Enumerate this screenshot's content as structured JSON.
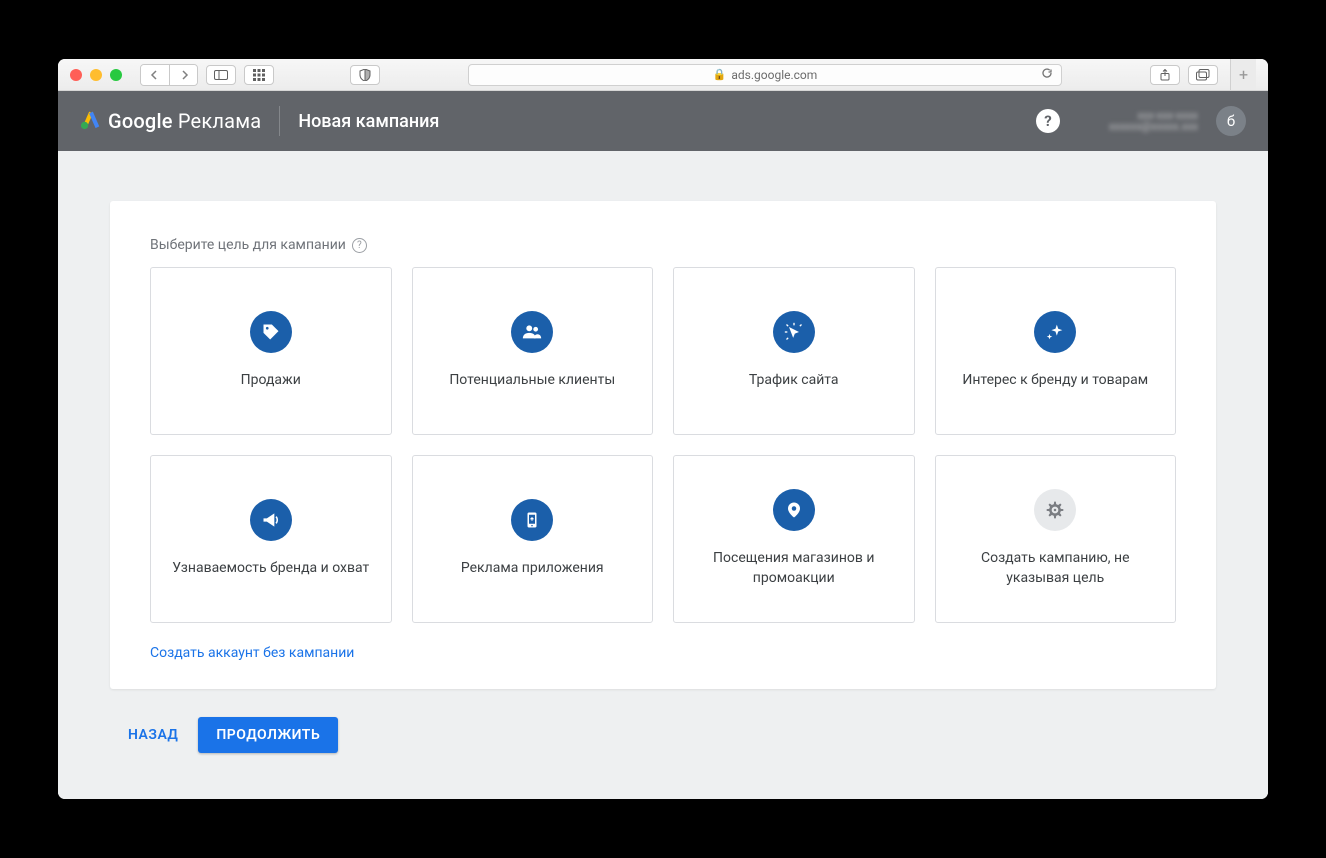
{
  "browser": {
    "url": "ads.google.com"
  },
  "header": {
    "logo_text_bold": "Google",
    "logo_text_light": "Реклама",
    "page_title": "Новая кампания",
    "avatar_letter": "б",
    "help_symbol": "?",
    "account_obscured": "ххх-ххх-хххх\nхххххх@ххххх.ххх"
  },
  "main": {
    "section_title": "Выберите цель для кампании",
    "goals": [
      {
        "label": "Продажи",
        "icon": "tag"
      },
      {
        "label": "Потенциальные клиенты",
        "icon": "people"
      },
      {
        "label": "Трафик сайта",
        "icon": "click"
      },
      {
        "label": "Интерес к бренду и товарам",
        "icon": "sparkle"
      },
      {
        "label": "Узнаваемость бренда и охват",
        "icon": "megaphone"
      },
      {
        "label": "Реклама приложения",
        "icon": "phone"
      },
      {
        "label": "Посещения магазинов и промоакции",
        "icon": "pin"
      },
      {
        "label": "Создать кампанию, не указывая цель",
        "icon": "gear",
        "gray": true
      }
    ],
    "create_account_link": "Создать аккаунт без кампании"
  },
  "footer": {
    "back": "НАЗАД",
    "continue": "ПРОДОЛЖИТЬ"
  }
}
